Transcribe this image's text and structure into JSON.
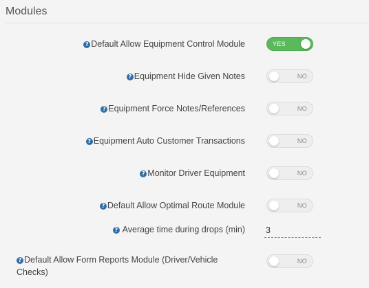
{
  "section": {
    "title": "Modules"
  },
  "help_glyph": "?",
  "settings": [
    {
      "label": "Default Allow Equipment Control Module",
      "state_label": "YES",
      "enabled": true
    },
    {
      "label": "Equipment Hide Given Notes",
      "state_label": "NO",
      "enabled": false
    },
    {
      "label": "Equipment Force Notes/References",
      "state_label": "NO",
      "enabled": false
    },
    {
      "label": "Equipment Auto Customer Transactions",
      "state_label": "NO",
      "enabled": false
    },
    {
      "label": "Monitor Driver Equipment",
      "state_label": "NO",
      "enabled": false
    },
    {
      "label": "Default Allow Optimal Route Module",
      "state_label": "NO",
      "enabled": false
    },
    {
      "label": "Average time during drops (min)",
      "value": "3"
    },
    {
      "label": "Default Allow Form Reports Module (Driver/Vehicle Checks)",
      "state_label": "NO",
      "enabled": false
    }
  ],
  "colors": {
    "toggle_on": "#5cb85c",
    "toggle_off": "#eeeeee",
    "help_icon": "#2e6da4"
  }
}
